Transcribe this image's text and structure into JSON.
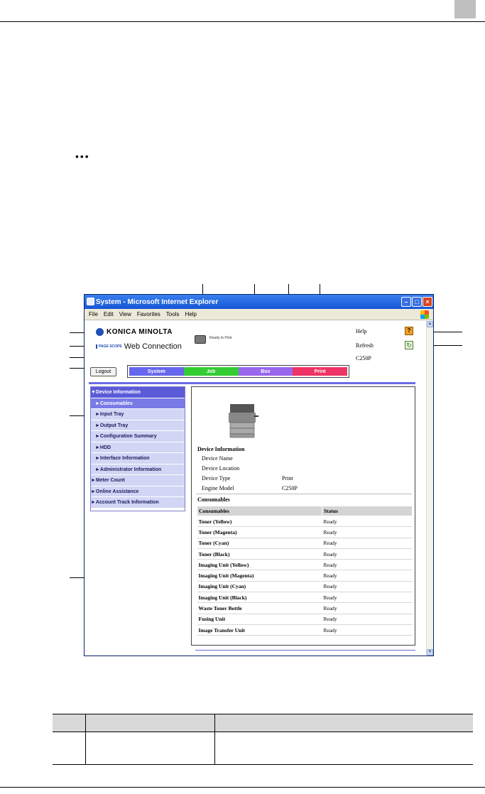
{
  "window": {
    "title": "System - Microsoft Internet Explorer",
    "menu": [
      "File",
      "Edit",
      "View",
      "Favorites",
      "Tools",
      "Help"
    ]
  },
  "header": {
    "brand": "KONICA MINOLTA",
    "pagescope": "PAGE SCOPE",
    "product": "Web Connection",
    "status": "Ready to Print",
    "help": "Help",
    "refresh": "Refresh",
    "model": "C250P",
    "logout": "Logout"
  },
  "tabs": [
    {
      "label": "System",
      "color": "#6666ee"
    },
    {
      "label": "Job",
      "color": "#33cc33"
    },
    {
      "label": "Box",
      "color": "#9966ee"
    },
    {
      "label": "Print",
      "color": "#ee3366"
    }
  ],
  "nav": [
    "▼Device Information",
    "►Consumables",
    "►Input Tray",
    "►Output Tray",
    "►Configuration Summary",
    "►HDD",
    "►Interface Information",
    "►Administrator Information",
    "►Meter Count",
    "►Online Assistance",
    "►Account Track Information"
  ],
  "device_info": {
    "title": "Device Information",
    "rows": [
      {
        "label": "Device Name",
        "value": ""
      },
      {
        "label": "Device Location",
        "value": ""
      },
      {
        "label": "Device Type",
        "value": "Print"
      },
      {
        "label": "Engine Model",
        "value": "C250P"
      }
    ]
  },
  "consumables": {
    "title": "Consumables",
    "headers": [
      "Consumables",
      "Status"
    ],
    "rows": [
      [
        "Toner (Yellow)",
        "Ready"
      ],
      [
        "Toner (Magenta)",
        "Ready"
      ],
      [
        "Toner (Cyan)",
        "Ready"
      ],
      [
        "Toner (Black)",
        "Ready"
      ],
      [
        "Imaging Unit (Yellow)",
        "Ready"
      ],
      [
        "Imaging Unit (Magenta)",
        "Ready"
      ],
      [
        "Imaging Unit (Cyan)",
        "Ready"
      ],
      [
        "Imaging Unit (Black)",
        "Ready"
      ],
      [
        "Waste Toner Bottle",
        "Ready"
      ],
      [
        "Fusing Unit",
        "Ready"
      ],
      [
        "Image Transfer Unit",
        "Ready"
      ]
    ]
  },
  "page": {
    "note_dots": "•••"
  }
}
